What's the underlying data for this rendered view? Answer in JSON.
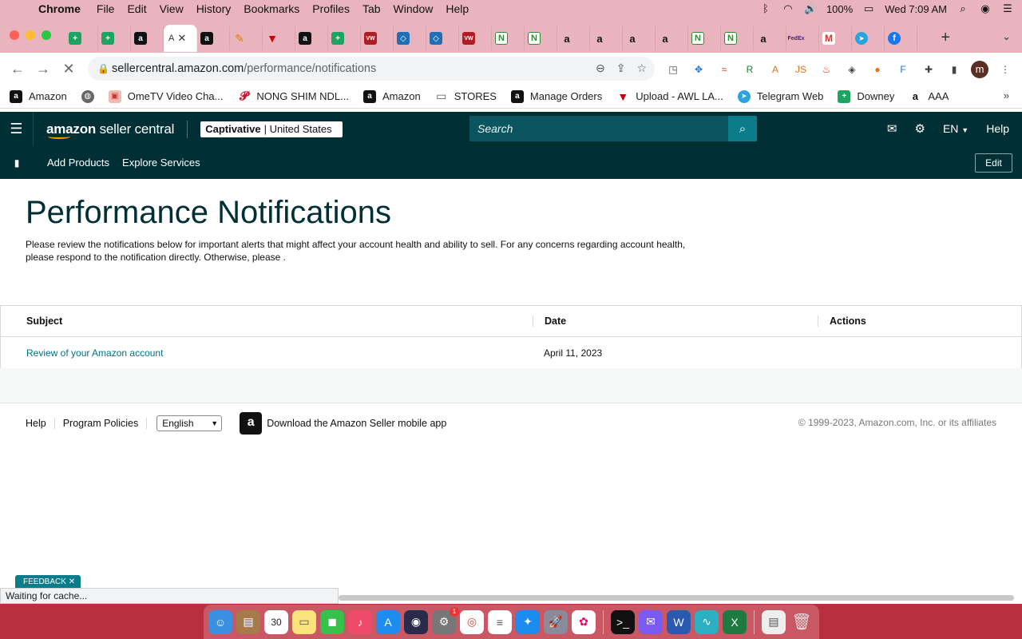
{
  "menubar": {
    "app": "Chrome",
    "items": [
      "File",
      "Edit",
      "View",
      "History",
      "Bookmarks",
      "Profiles",
      "Tab",
      "Window",
      "Help"
    ],
    "battery": "100%",
    "clock": "Wed 7:09 AM"
  },
  "tabs": {
    "active_label": "A",
    "new_tab": "+"
  },
  "address": {
    "host": "sellercentral.amazon.com",
    "path": "/performance/notifications"
  },
  "bookmarks": [
    {
      "label": "Amazon"
    },
    {
      "label": "OmeTV Video Cha..."
    },
    {
      "label": "NONG SHIM NDL..."
    },
    {
      "label": "Amazon"
    },
    {
      "label": "STORES"
    },
    {
      "label": "Manage Orders"
    },
    {
      "label": "Upload - AWL LA..."
    },
    {
      "label": "Telegram Web"
    },
    {
      "label": "Downey"
    },
    {
      "label": "AAA"
    }
  ],
  "header": {
    "logo_brand": "amazon",
    "logo_product": " seller central",
    "account_name": "Captivative",
    "account_region": "| United States",
    "search_placeholder": "Search",
    "language": "EN",
    "help": "Help"
  },
  "subnav": {
    "links": [
      "Add Products",
      "Explore Services"
    ],
    "edit": "Edit"
  },
  "page": {
    "title": "Performance Notifications",
    "intro": "Please review the notifications below for important alerts that might affect your account health and ability to sell. For any concerns regarding account health, please respond to the notification directly. Otherwise, please ."
  },
  "table": {
    "columns": [
      "Subject",
      "Date",
      "Actions"
    ],
    "rows": [
      {
        "subject": "Review of your Amazon account",
        "date": "April 11, 2023",
        "actions": ""
      }
    ]
  },
  "footer": {
    "help": "Help",
    "policies": "Program Policies",
    "language": "English",
    "app_text": "Download the Amazon Seller mobile app",
    "copyright": "© 1999-2023, Amazon.com, Inc. or its affiliates"
  },
  "feedback": "FEEDBACK",
  "status": "Waiting for cache...",
  "dock": {
    "calendar_day": "30",
    "badge": "1"
  },
  "colors": {
    "header_bg": "#002f36",
    "link": "#007185",
    "accent": "#ff9900"
  }
}
